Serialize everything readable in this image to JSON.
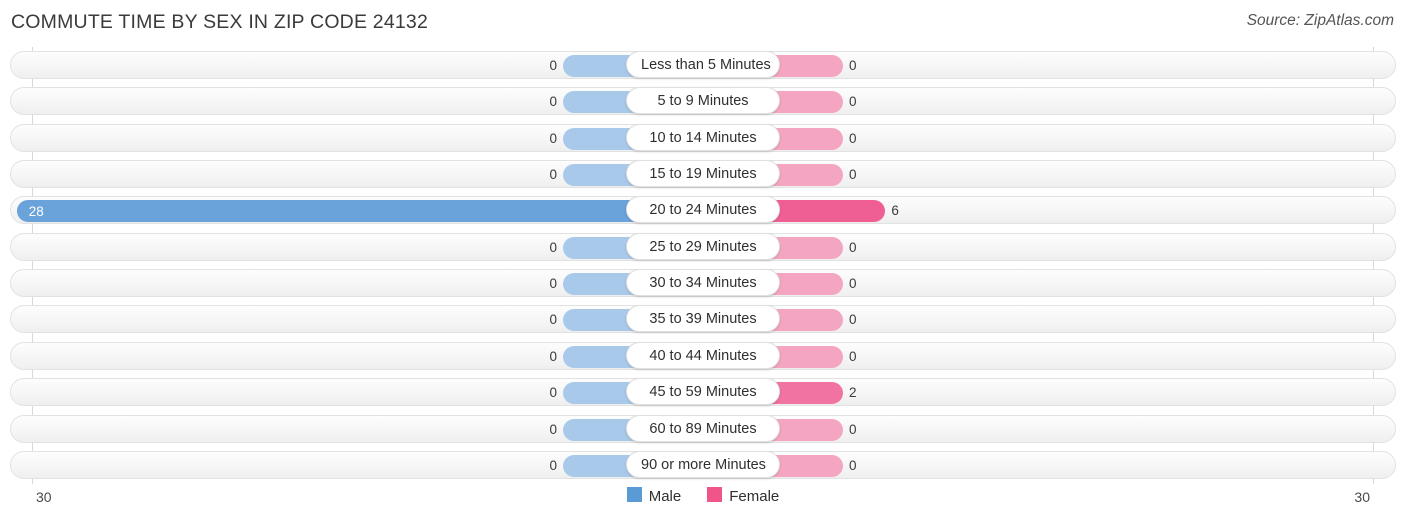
{
  "header": {
    "title": "COMMUTE TIME BY SEX IN ZIP CODE 24132",
    "source": "Source: ZipAtlas.com"
  },
  "axis": {
    "left_label": "30",
    "right_label": "30"
  },
  "legend": {
    "items": [
      {
        "label": "Male",
        "color": "#5b9bd5"
      },
      {
        "label": "Female",
        "color": "#ef5588"
      }
    ]
  },
  "colors": {
    "male": "#6aa2da",
    "male_zero": "#a9c9ea",
    "female": "#ef5f94",
    "female_mid": "#f073a2",
    "female_zero": "#f4a5c1",
    "track": "#f6f6f6"
  },
  "chart_data": {
    "type": "bar",
    "title": "COMMUTE TIME BY SEX IN ZIP CODE 24132",
    "subtitle": "Source: ZipAtlas.com",
    "orientation": "horizontal",
    "style": "diverging-butterfly",
    "xlabel": "",
    "ylabel": "",
    "xlim": [
      30,
      30
    ],
    "axis_left_max": 30,
    "axis_right_max": 30,
    "grid": false,
    "legend_position": "bottom-center",
    "categories": [
      "Less than 5 Minutes",
      "5 to 9 Minutes",
      "10 to 14 Minutes",
      "15 to 19 Minutes",
      "20 to 24 Minutes",
      "25 to 29 Minutes",
      "30 to 34 Minutes",
      "35 to 39 Minutes",
      "40 to 44 Minutes",
      "45 to 59 Minutes",
      "60 to 89 Minutes",
      "90 or more Minutes"
    ],
    "series": [
      {
        "name": "Male",
        "color": "#5b9bd5",
        "side": "left",
        "values": [
          0,
          0,
          0,
          0,
          28,
          0,
          0,
          0,
          0,
          0,
          0,
          0
        ]
      },
      {
        "name": "Female",
        "color": "#ef5588",
        "side": "right",
        "values": [
          0,
          0,
          0,
          0,
          6,
          0,
          0,
          0,
          0,
          2,
          0,
          0
        ]
      }
    ]
  },
  "rows": [
    {
      "label": "Less than 5 Minutes",
      "male": "0",
      "female": "0"
    },
    {
      "label": "5 to 9 Minutes",
      "male": "0",
      "female": "0"
    },
    {
      "label": "10 to 14 Minutes",
      "male": "0",
      "female": "0"
    },
    {
      "label": "15 to 19 Minutes",
      "male": "0",
      "female": "0"
    },
    {
      "label": "20 to 24 Minutes",
      "male": "28",
      "female": "6"
    },
    {
      "label": "25 to 29 Minutes",
      "male": "0",
      "female": "0"
    },
    {
      "label": "30 to 34 Minutes",
      "male": "0",
      "female": "0"
    },
    {
      "label": "35 to 39 Minutes",
      "male": "0",
      "female": "0"
    },
    {
      "label": "40 to 44 Minutes",
      "male": "0",
      "female": "0"
    },
    {
      "label": "45 to 59 Minutes",
      "male": "0",
      "female": "2"
    },
    {
      "label": "60 to 89 Minutes",
      "male": "0",
      "female": "0"
    },
    {
      "label": "90 or more Minutes",
      "male": "0",
      "female": "0"
    }
  ]
}
